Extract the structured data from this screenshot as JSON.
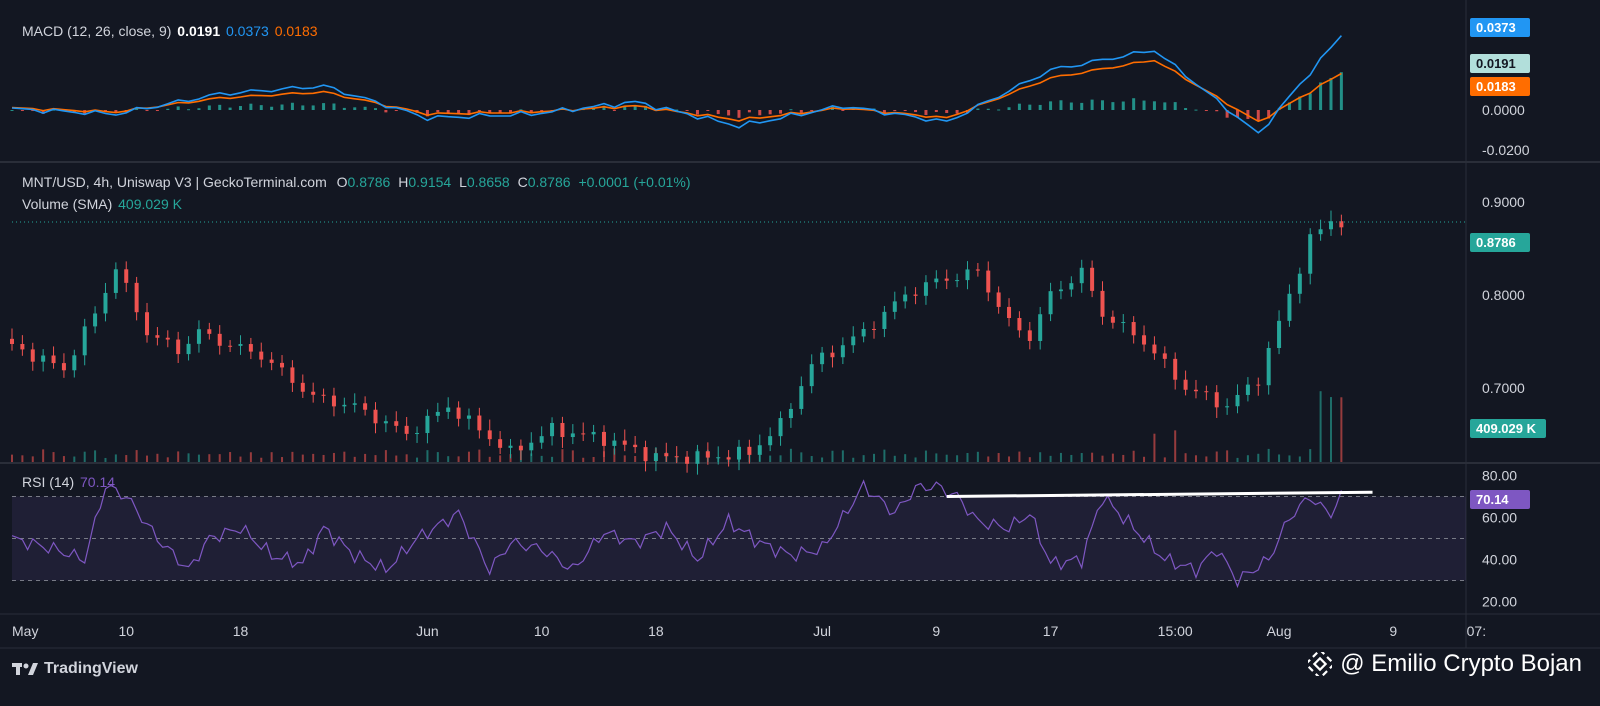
{
  "macd_legend": {
    "name": "MACD (12, 26, close, 9)",
    "hist": "0.0191",
    "macd": "0.0373",
    "signal": "0.0183"
  },
  "price_legend": {
    "symbol": "MNT/USD, 4h, Uniswap V3 | GeckoTerminal.com",
    "o_label": "O",
    "o": "0.8786",
    "h_label": "H",
    "h": "0.9154",
    "l_label": "L",
    "l": "0.8658",
    "c_label": "C",
    "c": "0.8786",
    "change": "+0.0001 (+0.01%)"
  },
  "volume_legend": {
    "name": "Volume (SMA)",
    "value": "409.029 K"
  },
  "rsi_legend": {
    "name": "RSI (14)",
    "value": "70.14"
  },
  "tags": {
    "macd": "0.0373",
    "hist": "0.0191",
    "signal": "0.0183",
    "price": "0.8786",
    "volume": "409.029 K",
    "rsi": "70.14"
  },
  "footer": {
    "brand": "TradingView",
    "watermark": "@ Emilio Crypto Bojan"
  },
  "colors": {
    "up": "#26a69a",
    "down": "#ef5350",
    "macd": "#2196f3",
    "signal": "#ff6d00",
    "rsi": "#7e57c2",
    "bg": "#131722"
  },
  "chart_data": [
    {
      "type": "line",
      "title": "MACD (12, 26, close, 9)",
      "ylim": [
        -0.025,
        0.05
      ],
      "yticks": [
        "-0.0200",
        "0.0000",
        "0.0373"
      ],
      "series": [
        {
          "name": "MACD",
          "x": [
            0,
            10,
            20,
            30,
            40,
            50,
            60,
            70,
            80,
            90,
            100,
            110,
            120,
            128
          ],
          "values": [
            0.0005,
            -0.002,
            0.008,
            0.012,
            -0.004,
            -0.002,
            0.004,
            -0.008,
            0.002,
            -0.006,
            0.02,
            0.03,
            -0.012,
            0.0373
          ]
        },
        {
          "name": "Signal",
          "x": [
            0,
            10,
            20,
            30,
            40,
            50,
            60,
            70,
            80,
            90,
            100,
            110,
            120,
            128
          ],
          "values": [
            0.001,
            -0.001,
            0.006,
            0.009,
            -0.002,
            -0.001,
            0.002,
            -0.005,
            0.001,
            -0.004,
            0.016,
            0.025,
            -0.006,
            0.0183
          ]
        }
      ]
    },
    {
      "type": "line",
      "title": "MNT/USD, 4h, Uniswap V3 | GeckoTerminal.com",
      "ylim": [
        0.62,
        0.94
      ],
      "yticks": [
        "0.7000",
        "0.8000",
        "0.9000"
      ],
      "x_tick_labels": [
        "May",
        "10",
        "18",
        "Jun",
        "10",
        "18",
        "Jul",
        "9",
        "17",
        "15:00",
        "Aug",
        "9",
        "07:"
      ],
      "series": [
        {
          "name": "Close",
          "x": [
            0,
            6,
            9,
            11,
            14,
            17,
            19,
            21,
            25,
            30,
            34,
            39,
            43,
            49,
            53,
            58,
            63,
            68,
            72,
            75,
            78,
            83,
            87,
            90,
            94,
            97,
            99,
            101,
            104,
            106,
            110,
            114,
            118,
            121,
            124,
            126,
            128,
            129
          ],
          "values": [
            0.75,
            0.72,
            0.78,
            0.83,
            0.76,
            0.74,
            0.76,
            0.75,
            0.735,
            0.69,
            0.68,
            0.65,
            0.68,
            0.63,
            0.655,
            0.645,
            0.625,
            0.625,
            0.63,
            0.66,
            0.725,
            0.76,
            0.8,
            0.815,
            0.825,
            0.77,
            0.755,
            0.8,
            0.825,
            0.78,
            0.75,
            0.7,
            0.68,
            0.71,
            0.8,
            0.86,
            0.88,
            0.8786
          ]
        }
      ]
    },
    {
      "type": "line",
      "title": "RSI (14)",
      "ylim": [
        20,
        80
      ],
      "yticks": [
        "20.00",
        "40.00",
        "60.00",
        "80.00"
      ],
      "series": [
        {
          "name": "RSI",
          "x": [
            0,
            4,
            7,
            9,
            11,
            14,
            17,
            19,
            22,
            25,
            28,
            30,
            33,
            36,
            39,
            43,
            46,
            48,
            51,
            54,
            57,
            60,
            63,
            66,
            69,
            72,
            75,
            78,
            80,
            82,
            85,
            87,
            89,
            91,
            93,
            96,
            98,
            100,
            103,
            105,
            108,
            111,
            114,
            116,
            118,
            121,
            123,
            125,
            126,
            127,
            128
          ],
          "values": [
            50,
            45,
            40,
            75,
            70,
            50,
            35,
            50,
            55,
            42,
            38,
            55,
            42,
            35,
            50,
            62,
            35,
            48,
            45,
            35,
            53,
            48,
            55,
            40,
            58,
            48,
            42,
            45,
            60,
            75,
            62,
            74,
            75,
            70,
            58,
            55,
            62,
            38,
            40,
            70,
            55,
            40,
            35,
            45,
            30,
            40,
            60,
            70,
            65,
            62,
            70.14
          ]
        }
      ]
    }
  ]
}
